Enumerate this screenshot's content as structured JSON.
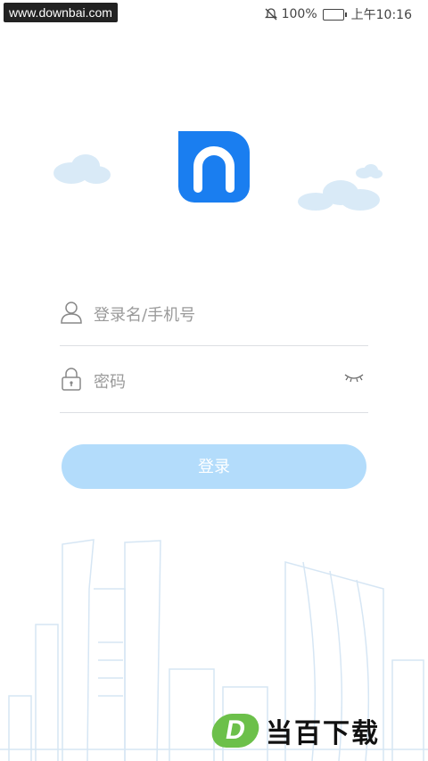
{
  "watermark": "www.downbai.com",
  "status": {
    "battery_percent": "100%",
    "time": "上午10:16"
  },
  "login": {
    "username_placeholder": "登录名/手机号",
    "password_placeholder": "密码",
    "submit_label": "登录"
  },
  "brand": {
    "d_letter": "D",
    "name": "当百下载"
  },
  "colors": {
    "logo_blue": "#1a7ef0",
    "button_bg": "#b3dcfb",
    "cloud": "#d9eaf7"
  }
}
